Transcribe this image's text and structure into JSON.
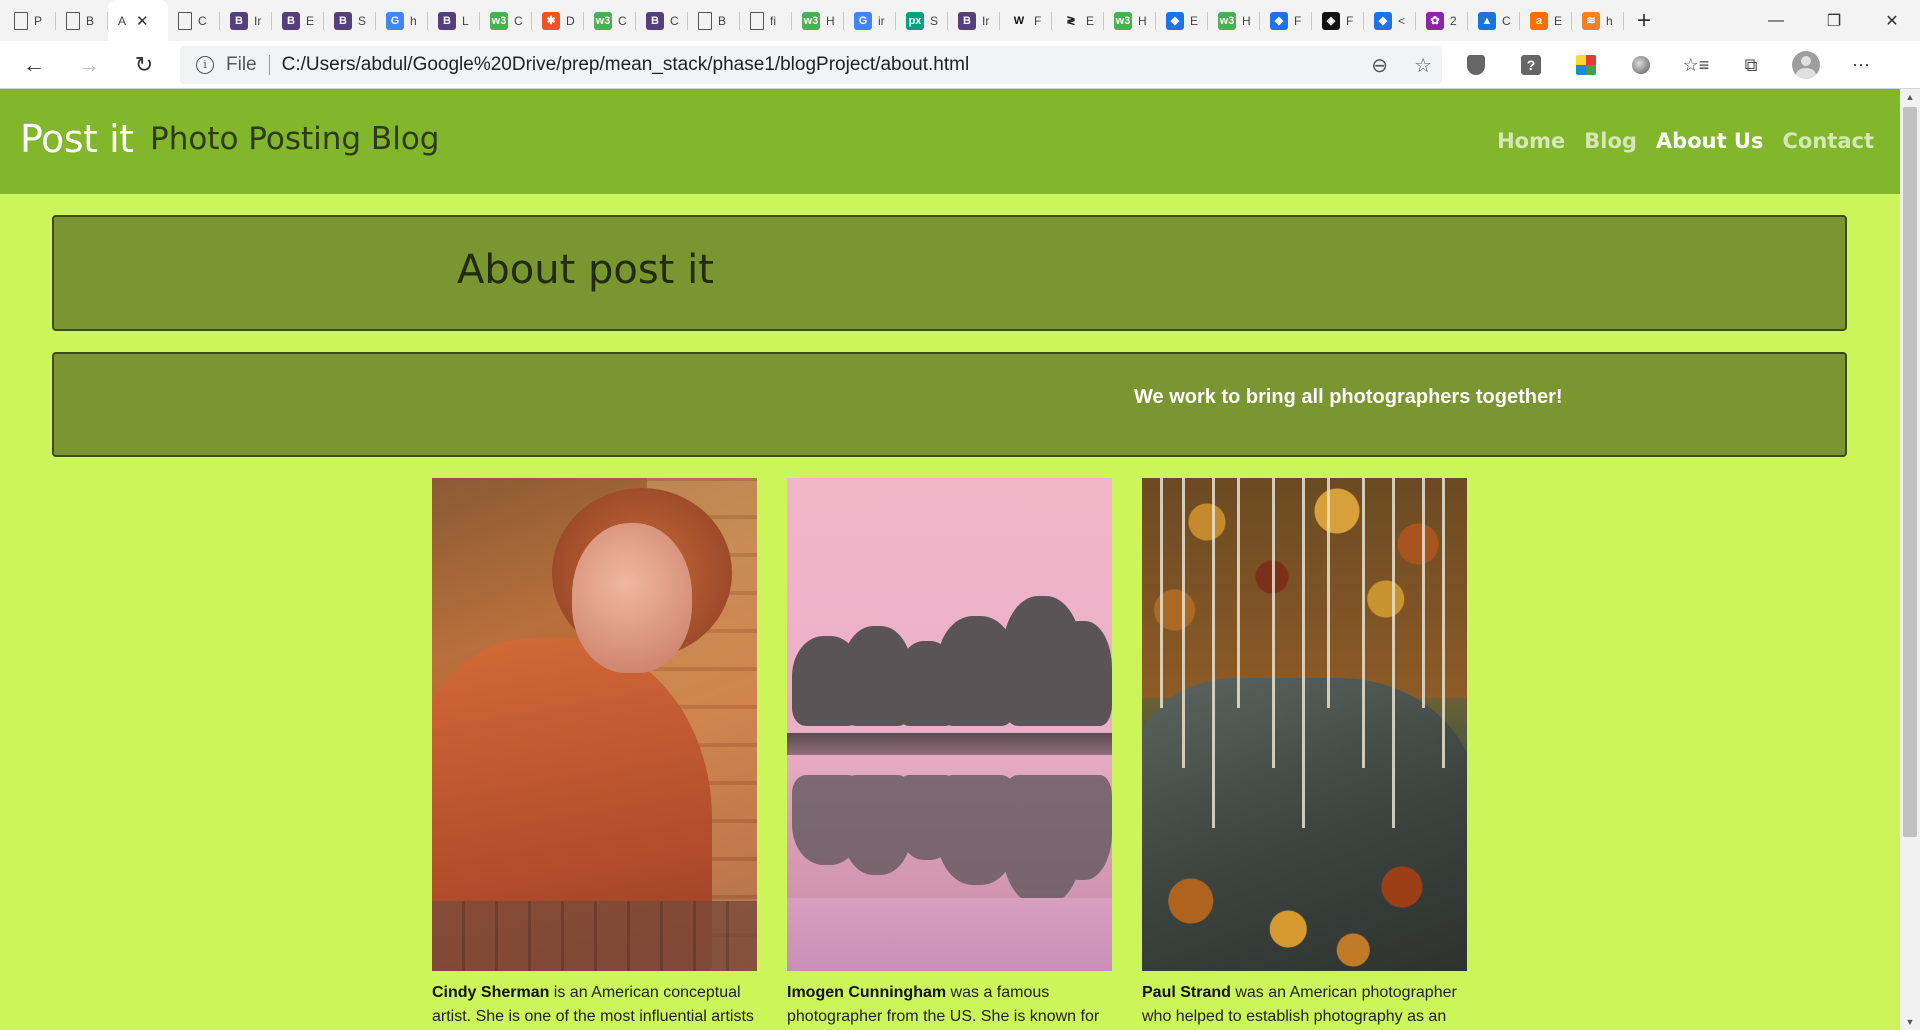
{
  "browser": {
    "active_tab": {
      "title": "A",
      "close_icon": "✕"
    },
    "tabs": [
      {
        "favicon": "page-icon",
        "title": "P"
      },
      {
        "favicon": "page-icon",
        "title": "B"
      },
      {
        "favicon": "active",
        "title": "A"
      },
      {
        "favicon": "page-icon",
        "title": "C"
      },
      {
        "favicon": "bootstrap-icon",
        "label": "B",
        "color": "#563d7c",
        "title": "Ir"
      },
      {
        "favicon": "bootstrap-icon",
        "label": "B",
        "color": "#563d7c",
        "title": "E"
      },
      {
        "favicon": "bootstrap-icon",
        "label": "B",
        "color": "#563d7c",
        "title": "S"
      },
      {
        "favicon": "google-icon",
        "label": "G",
        "color": "#4285f4",
        "title": "h"
      },
      {
        "favicon": "bootstrap-icon",
        "label": "B",
        "color": "#563d7c",
        "title": "L"
      },
      {
        "favicon": "w3schools-icon",
        "label": "w3",
        "color": "#4caf50",
        "title": "C"
      },
      {
        "favicon": "asterisk-icon",
        "label": "✱",
        "color": "#f4511e",
        "title": "D"
      },
      {
        "favicon": "w3schools-icon",
        "label": "w3",
        "color": "#4caf50",
        "title": "C"
      },
      {
        "favicon": "bootstrap-icon",
        "label": "B",
        "color": "#563d7c",
        "title": "C"
      },
      {
        "favicon": "page-icon",
        "title": "B"
      },
      {
        "favicon": "page-icon",
        "title": "fi"
      },
      {
        "favicon": "w3schools-icon",
        "label": "w3",
        "color": "#4caf50",
        "title": "H"
      },
      {
        "favicon": "google-icon",
        "label": "G",
        "color": "#4285f4",
        "title": "ir"
      },
      {
        "favicon": "pexels-icon",
        "label": "px",
        "color": "#05a081",
        "title": "S"
      },
      {
        "favicon": "bootstrap-icon",
        "label": "B",
        "color": "#563d7c",
        "title": "Ir"
      },
      {
        "favicon": "wikipedia-icon",
        "label": "W",
        "color": "#ffffff",
        "title": "F"
      },
      {
        "favicon": "code-icon",
        "label": "≷",
        "color": "#ffffff",
        "title": "E"
      },
      {
        "favicon": "w3schools-icon",
        "label": "w3",
        "color": "#4caf50",
        "title": "H"
      },
      {
        "favicon": "mdn-icon",
        "label": "◆",
        "color": "#1a73e8",
        "title": "E"
      },
      {
        "favicon": "w3schools-icon",
        "label": "w3",
        "color": "#4caf50",
        "title": "H"
      },
      {
        "favicon": "mdn-icon",
        "label": "◆",
        "color": "#1a73e8",
        "title": "F"
      },
      {
        "favicon": "codesandbox-icon",
        "label": "◈",
        "color": "#111111",
        "title": "F"
      },
      {
        "favicon": "mdn-icon",
        "label": "◆",
        "color": "#1a73e8",
        "title": "<"
      },
      {
        "favicon": "colorful-icon",
        "label": "✿",
        "color": "#8e24aa",
        "title": "2"
      },
      {
        "favicon": "angular-icon",
        "label": "▲",
        "color": "#1976d2",
        "title": "C"
      },
      {
        "favicon": "a-icon",
        "label": "a",
        "color": "#ff6d00",
        "title": "E"
      },
      {
        "favicon": "stackoverflow-icon",
        "label": "≋",
        "color": "#f48024",
        "title": "h"
      }
    ],
    "new_tab_icon": "+",
    "window_controls": {
      "minimize": "—",
      "restore": "❐",
      "close": "✕"
    },
    "nav": {
      "back": "←",
      "forward": "→",
      "reload": "↻"
    },
    "address": {
      "scheme_label": "File",
      "url": "C:/Users/abdul/Google%20Drive/prep/mean_stack/phase1/blogProject/about.html",
      "zoom_icon": "⊖",
      "star_icon": "☆"
    },
    "toolbar_icons": {
      "favorites": "☆≡",
      "collections": "⧉",
      "more": "⋯"
    }
  },
  "site": {
    "brand": "Post it",
    "tagline": "Photo Posting Blog",
    "nav": [
      {
        "label": "Home",
        "active": false
      },
      {
        "label": "Blog",
        "active": false
      },
      {
        "label": "About Us",
        "active": true
      },
      {
        "label": "Contact",
        "active": false
      }
    ],
    "about_title": "About post it",
    "mission": "We work to bring all photographers together!",
    "photographers": [
      {
        "name": "Cindy Sherman",
        "text": " is an American conceptual artist. She is one of the most influential artists"
      },
      {
        "name": "Imogen Cunningham",
        "text": " was a famous photographer from the US. She is known for"
      },
      {
        "name": "Paul Strand",
        "text": " was an American photographer who helped to establish photography as an"
      }
    ],
    "colors": {
      "page_bg": "#ccf55a",
      "header_bg": "#82b62b",
      "panel_bg": "#7a9630",
      "panel_border": "#3b4a16"
    }
  }
}
